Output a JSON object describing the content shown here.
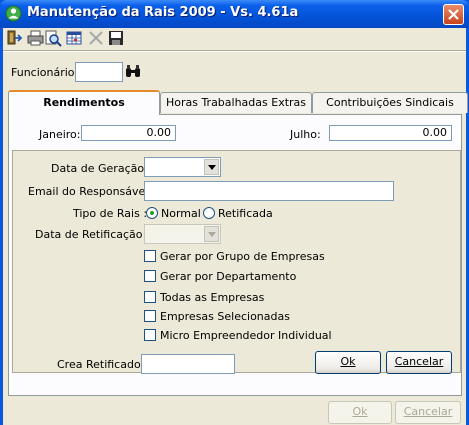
{
  "window": {
    "title": "Manutenção da Rais 2009 - Vs. 4.61a"
  },
  "toolbar": {
    "buttons": [
      "exit-icon",
      "print-icon",
      "print-preview-icon",
      "export-grid-icon",
      "delete-icon",
      "save-icon"
    ]
  },
  "funcionario": {
    "label": "Funcionário:",
    "value": ""
  },
  "tabs": [
    {
      "label": "Rendimentos",
      "active": true
    },
    {
      "label": "Horas Trabalhadas Extras",
      "active": false
    },
    {
      "label": "Contribuições Sindicais",
      "active": false
    }
  ],
  "months": [
    {
      "label": "Janeiro:",
      "value": "0.00"
    },
    {
      "label": "Julho:",
      "value": "0.00"
    }
  ],
  "form": {
    "data_geracao_label": "Data de Geração :",
    "data_geracao_value": "",
    "email_label": "Email do Responsável :",
    "email_value": "",
    "tipo_label": "Tipo de Rais :",
    "tipo_options": [
      {
        "label": "Normal",
        "selected": true
      },
      {
        "label": "Retificada",
        "selected": false
      }
    ],
    "data_retificacao_label": "Data de Retificação :",
    "data_retificacao_value": "",
    "checkboxes": [
      {
        "label": "Gerar por Grupo de Empresas",
        "checked": false
      },
      {
        "label": "Gerar por Departamento",
        "checked": false
      },
      {
        "label": "Todas as Empresas",
        "checked": false
      },
      {
        "label": "Empresas Selecionadas",
        "checked": false
      },
      {
        "label": "Micro Empreendedor Individual",
        "checked": false
      }
    ],
    "crea_label": "Crea Retificado :",
    "crea_value": "",
    "ok_label": "Ok",
    "cancel_label": "Cancelar"
  },
  "footer": {
    "ok_label": "Ok",
    "cancel_label": "Cancelar"
  },
  "colors": {
    "titlebar": "#0453d8",
    "window_face": "#ece9d8",
    "active_tab_accent": "#e68b2c"
  }
}
